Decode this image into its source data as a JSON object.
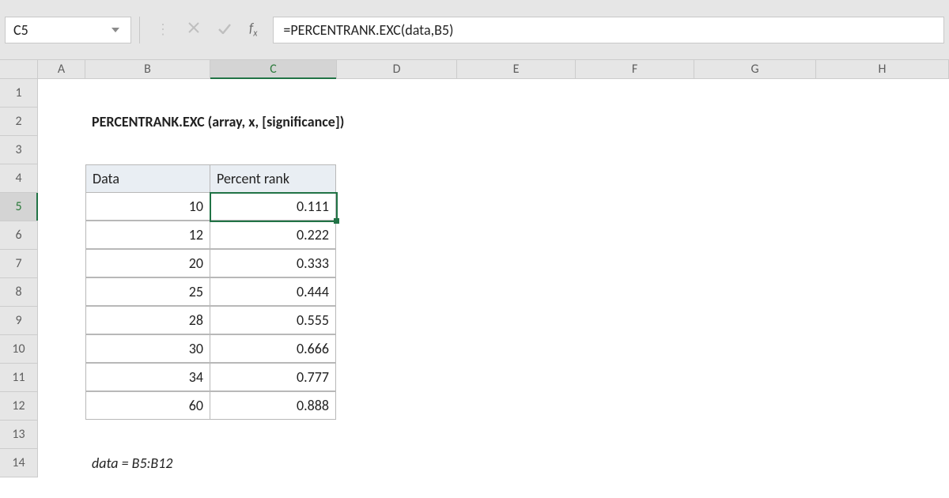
{
  "formula_bar": {
    "cell_ref": "C5",
    "formula": "=PERCENTRANK.EXC(data,B5)"
  },
  "columns": [
    "A",
    "B",
    "C",
    "D",
    "E",
    "F",
    "G",
    "H"
  ],
  "row_numbers": [
    "1",
    "2",
    "3",
    "4",
    "5",
    "6",
    "7",
    "8",
    "9",
    "10",
    "11",
    "12",
    "13",
    "14"
  ],
  "active_col": "C",
  "active_row": "5",
  "content": {
    "title": "PERCENTRANK.EXC (array, x, [significance])",
    "headers": {
      "data": "Data",
      "rank": "Percent rank"
    },
    "rows": [
      {
        "data": "10",
        "rank": "0.111"
      },
      {
        "data": "12",
        "rank": "0.222"
      },
      {
        "data": "20",
        "rank": "0.333"
      },
      {
        "data": "25",
        "rank": "0.444"
      },
      {
        "data": "28",
        "rank": "0.555"
      },
      {
        "data": "30",
        "rank": "0.666"
      },
      {
        "data": "34",
        "rank": "0.777"
      },
      {
        "data": "60",
        "rank": "0.888"
      }
    ],
    "note": "data = B5:B12"
  }
}
